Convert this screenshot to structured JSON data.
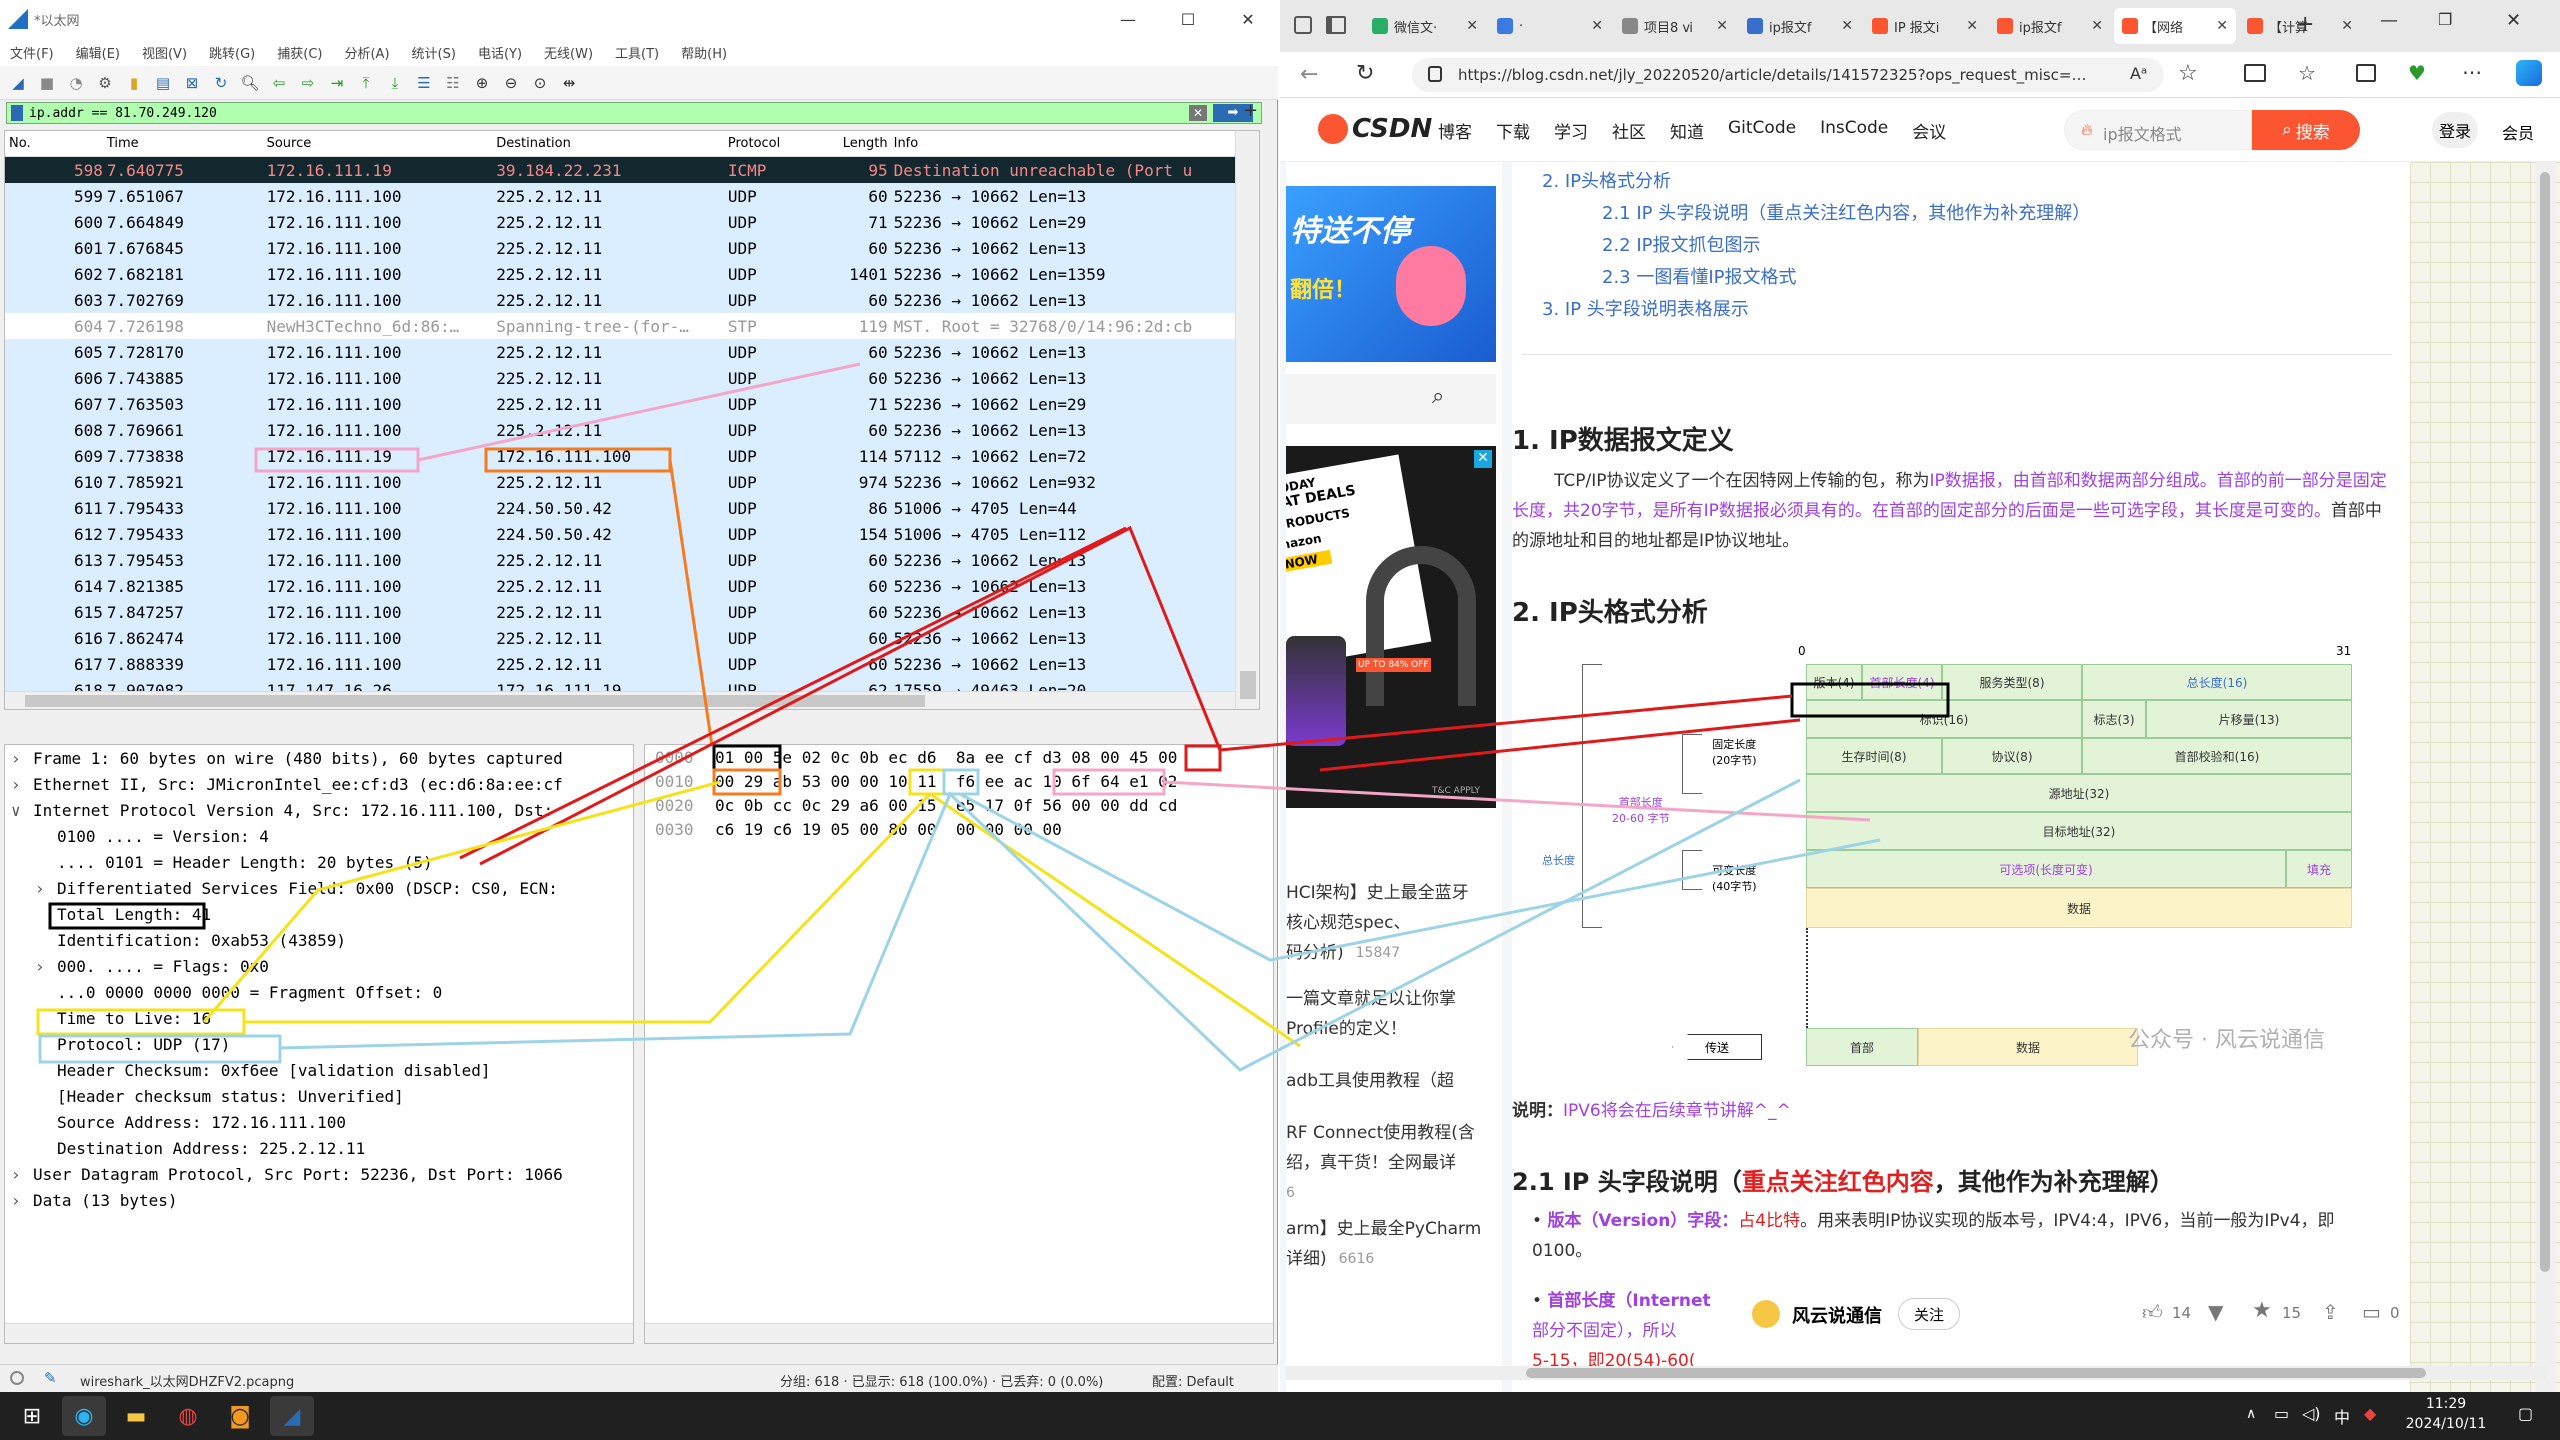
{
  "wireshark": {
    "title": "*以太网",
    "menu": [
      "文件(F)",
      "编辑(E)",
      "视图(V)",
      "跳转(G)",
      "捕获(C)",
      "分析(A)",
      "统计(S)",
      "电话(Y)",
      "无线(W)",
      "工具(T)",
      "帮助(H)"
    ],
    "filter": "ip.addr == 81.70.249.120",
    "columns": {
      "no": "No.",
      "time": "Time",
      "source": "Source",
      "destination": "Destination",
      "protocol": "Protocol",
      "length": "Length",
      "info": "Info"
    },
    "packets": [
      {
        "no": "598",
        "time": "7.640775",
        "src": "172.16.111.19",
        "dst": "39.184.22.231",
        "proto": "ICMP",
        "len": "95",
        "info": "Destination unreachable (Port u",
        "style": "sel"
      },
      {
        "no": "599",
        "time": "7.651067",
        "src": "172.16.111.100",
        "dst": "225.2.12.11",
        "proto": "UDP",
        "len": "60",
        "info": "52236 → 10662 Len=13",
        "style": "udp"
      },
      {
        "no": "600",
        "time": "7.664849",
        "src": "172.16.111.100",
        "dst": "225.2.12.11",
        "proto": "UDP",
        "len": "71",
        "info": "52236 → 10662 Len=29",
        "style": "udp"
      },
      {
        "no": "601",
        "time": "7.676845",
        "src": "172.16.111.100",
        "dst": "225.2.12.11",
        "proto": "UDP",
        "len": "60",
        "info": "52236 → 10662 Len=13",
        "style": "udp"
      },
      {
        "no": "602",
        "time": "7.682181",
        "src": "172.16.111.100",
        "dst": "225.2.12.11",
        "proto": "UDP",
        "len": "1401",
        "info": "52236 → 10662 Len=1359",
        "style": "udp"
      },
      {
        "no": "603",
        "time": "7.702769",
        "src": "172.16.111.100",
        "dst": "225.2.12.11",
        "proto": "UDP",
        "len": "60",
        "info": "52236 → 10662 Len=13",
        "style": "udp"
      },
      {
        "no": "604",
        "time": "7.726198",
        "src": "NewH3CTechno_6d:86:…",
        "dst": "Spanning-tree-(for-…",
        "proto": "STP",
        "len": "119",
        "info": "MST. Root = 32768/0/14:96:2d:cb",
        "style": "stp"
      },
      {
        "no": "605",
        "time": "7.728170",
        "src": "172.16.111.100",
        "dst": "225.2.12.11",
        "proto": "UDP",
        "len": "60",
        "info": "52236 → 10662 Len=13",
        "style": "udp"
      },
      {
        "no": "606",
        "time": "7.743885",
        "src": "172.16.111.100",
        "dst": "225.2.12.11",
        "proto": "UDP",
        "len": "60",
        "info": "52236 → 10662 Len=13",
        "style": "udp"
      },
      {
        "no": "607",
        "time": "7.763503",
        "src": "172.16.111.100",
        "dst": "225.2.12.11",
        "proto": "UDP",
        "len": "71",
        "info": "52236 → 10662 Len=29",
        "style": "udp"
      },
      {
        "no": "608",
        "time": "7.769661",
        "src": "172.16.111.100",
        "dst": "225.2.12.11",
        "proto": "UDP",
        "len": "60",
        "info": "52236 → 10662 Len=13",
        "style": "udp"
      },
      {
        "no": "609",
        "time": "7.773838",
        "src": "172.16.111.19",
        "dst": "172.16.111.100",
        "proto": "UDP",
        "len": "114",
        "info": "57112 → 10662 Len=72",
        "style": "udp"
      },
      {
        "no": "610",
        "time": "7.785921",
        "src": "172.16.111.100",
        "dst": "225.2.12.11",
        "proto": "UDP",
        "len": "974",
        "info": "52236 → 10662 Len=932",
        "style": "udp"
      },
      {
        "no": "611",
        "time": "7.795433",
        "src": "172.16.111.100",
        "dst": "224.50.50.42",
        "proto": "UDP",
        "len": "86",
        "info": "51006 → 4705 Len=44",
        "style": "udp"
      },
      {
        "no": "612",
        "time": "7.795433",
        "src": "172.16.111.100",
        "dst": "224.50.50.42",
        "proto": "UDP",
        "len": "154",
        "info": "51006 → 4705 Len=112",
        "style": "udp"
      },
      {
        "no": "613",
        "time": "7.795453",
        "src": "172.16.111.100",
        "dst": "225.2.12.11",
        "proto": "UDP",
        "len": "60",
        "info": "52236 → 10662 Len=13",
        "style": "udp"
      },
      {
        "no": "614",
        "time": "7.821385",
        "src": "172.16.111.100",
        "dst": "225.2.12.11",
        "proto": "UDP",
        "len": "60",
        "info": "52236 → 10662 Len=13",
        "style": "udp"
      },
      {
        "no": "615",
        "time": "7.847257",
        "src": "172.16.111.100",
        "dst": "225.2.12.11",
        "proto": "UDP",
        "len": "60",
        "info": "52236 → 10662 Len=13",
        "style": "udp"
      },
      {
        "no": "616",
        "time": "7.862474",
        "src": "172.16.111.100",
        "dst": "225.2.12.11",
        "proto": "UDP",
        "len": "60",
        "info": "52236 → 10662 Len=13",
        "style": "udp"
      },
      {
        "no": "617",
        "time": "7.888339",
        "src": "172.16.111.100",
        "dst": "225.2.12.11",
        "proto": "UDP",
        "len": "60",
        "info": "52236 → 10662 Len=13",
        "style": "udp"
      },
      {
        "no": "618",
        "time": "7.907082",
        "src": "117.147.16.26",
        "dst": "172.16.111.19",
        "proto": "UDP",
        "len": "62",
        "info": "17559 → 49463 Len=20",
        "style": "udp"
      }
    ],
    "details": [
      {
        "text": "Frame 1: 60 bytes on wire (480 bits), 60 bytes captured",
        "indent": 0,
        "exp": "›"
      },
      {
        "text": "Ethernet II, Src: JMicronIntel_ee:cf:d3 (ec:d6:8a:ee:cf",
        "indent": 0,
        "exp": "›"
      },
      {
        "text": "Internet Protocol Version 4, Src: 172.16.111.100, Dst:",
        "indent": 0,
        "exp": "∨"
      },
      {
        "text": "0100 .... = Version: 4",
        "indent": 2,
        "exp": ""
      },
      {
        "text": ".... 0101 = Header Length: 20 bytes (5)",
        "indent": 2,
        "exp": ""
      },
      {
        "text": "Differentiated Services Field: 0x00 (DSCP: CS0, ECN:",
        "indent": 2,
        "exp": "›"
      },
      {
        "text": "Total Length: 41",
        "indent": 2,
        "exp": ""
      },
      {
        "text": "Identification: 0xab53 (43859)",
        "indent": 2,
        "exp": ""
      },
      {
        "text": "000. .... = Flags: 0x0",
        "indent": 2,
        "exp": "›"
      },
      {
        "text": "...0 0000 0000 0000 = Fragment Offset: 0",
        "indent": 2,
        "exp": ""
      },
      {
        "text": "Time to Live: 16",
        "indent": 2,
        "exp": ""
      },
      {
        "text": "Protocol: UDP (17)",
        "indent": 2,
        "exp": ""
      },
      {
        "text": "Header Checksum: 0xf6ee [validation disabled]",
        "indent": 2,
        "exp": ""
      },
      {
        "text": "[Header checksum status: Unverified]",
        "indent": 2,
        "exp": ""
      },
      {
        "text": "Source Address: 172.16.111.100",
        "indent": 2,
        "exp": ""
      },
      {
        "text": "Destination Address: 225.2.12.11",
        "indent": 2,
        "exp": ""
      },
      {
        "text": "User Datagram Protocol, Src Port: 52236, Dst Port: 1066",
        "indent": 0,
        "exp": "›"
      },
      {
        "text": "Data (13 bytes)",
        "indent": 0,
        "exp": "›"
      }
    ],
    "bytes": [
      {
        "off": "0000",
        "hex": "01 00 5e 02 0c 0b ec d6  8a ee cf d3 08 00 45 00"
      },
      {
        "off": "0010",
        "hex": "00 29 ab 53 00 00 10 11  f6 ee ac 10 6f 64 e1 02"
      },
      {
        "off": "0020",
        "hex": "0c 0b cc 0c 29 a6 00 15  e5 17 0f 56 00 00 dd cd"
      },
      {
        "off": "0030",
        "hex": "c6 19 c6 19 05 00 80 00  00 00 00 00"
      }
    ],
    "status": {
      "file": "wireshark_以太网DHZFV2.pcapng",
      "counts": "分组: 618 · 已显示: 618 (100.0%) · 已丢弃: 0 (0.0%)",
      "profile": "配置: Default"
    }
  },
  "browser": {
    "tabs": [
      {
        "label": "微信文·",
        "color": "#2aae67"
      },
      {
        "label": "·",
        "color": "#3b7be0"
      },
      {
        "label": "项目8 ⅵ",
        "color": "#888"
      },
      {
        "label": "ip报文f",
        "color": "#3a6ecc"
      },
      {
        "label": "IP 报文i",
        "color": "#fc5531"
      },
      {
        "label": "ip报文f",
        "color": "#fc5531"
      },
      {
        "label": "【网络",
        "color": "#fc5531"
      },
      {
        "label": "【计算",
        "color": "#fc5531"
      }
    ],
    "url": "https://blog.csdn.net/jly_20220520/article/details/141572325?ops_request_misc=…",
    "csdn": {
      "logo": "CSDN",
      "nav": [
        "博客",
        "下载",
        "学习",
        "社区",
        "知道",
        "GitCode",
        "InsCode",
        "会议"
      ],
      "search_placeholder": "ip报文格式",
      "search_btn": "搜索",
      "login": "登录",
      "member": "会员"
    },
    "toc": [
      {
        "text": "2. IP头格式分析",
        "level": 1
      },
      {
        "text": "2.1 IP 头字段说明（重点关注红色内容，其他作为补充理解）",
        "level": 2
      },
      {
        "text": "2.2 IP报文抓包图示",
        "level": 2
      },
      {
        "text": "2.3 一图看懂IP报文格式",
        "level": 2
      },
      {
        "text": "3. IP 头字段说明表格展示",
        "level": 1
      }
    ],
    "sec1_title": "1. IP数据报文定义",
    "sec1_p1": "TCP/IP协议定义了一个在因特网上传输的包，称为",
    "sec1_p1b": "IP数据报，由首部和数据两部分组成。首部的前一部分是固定长度，共20字节，是所有IP数据报必须具有的。在首部的固定部分的后面是一些可选字段，其长度是可变的。",
    "sec1_p1c": "首部中的源地址和目的地址都是IP协议地址。",
    "sec2_title": "2. IP头格式分析",
    "note_label": "说明：",
    "note_text": "IPV6将会在后续章节讲解^_^",
    "sec21_title_a": "2.1 IP 头字段说明（",
    "sec21_title_b": "重点关注红色内容",
    "sec21_title_c": "，其他作为补充理解）",
    "bullet1_a": "版本（Version）字段：",
    "bullet1_b": "占4比特",
    "bullet1_c": "。用来表明IP协议实现的版本号，IPV4:4，IPV6，当前一般为IPv4，即0100。",
    "bullet2_a": "首部长度（Internet",
    "bullet2_b": "部分不固定），所以",
    "bullet2_c": "5-15，即20(54)-60(",
    "diagram": {
      "scale0": "0",
      "scale31": "31",
      "row1": [
        "版本(4)",
        "首部长度(4)",
        "服务类型(8)",
        "总长度(16)"
      ],
      "row2": [
        "标识(16)",
        "标志(3)",
        "片移量(13)"
      ],
      "row3": [
        "生存时间(8)",
        "协议(8)",
        "首部校验和(16)"
      ],
      "src": "源地址(32)",
      "dst": "目标地址(32)",
      "opt": "可选项(长度可变)",
      "pad": "填充",
      "data": "数据",
      "fixed": "固定长度\n(20字节)",
      "var": "可变长度\n(40字节)",
      "total": "总长度",
      "hdrlen": "首部长度\n20-60 字节",
      "send": "传送",
      "hdr": "首部",
      "body": "数据",
      "watermark": "公众号 · 风云说通信"
    },
    "left_items": [
      "HCI架构】史上最全蓝牙",
      "核心规范spec、",
      "码分析)",
      "15847",
      "一篇文章就足以让你掌",
      "Profile的定义！",
      "adb工具使用教程（超",
      "RF Connect使用教程(含",
      "绍，真干货！全网最详",
      "6",
      "arm】史上最全PyCharm",
      "详细)",
      "6616"
    ],
    "ad_banner_text": "特送不停",
    "ad_banner_sub": "翻倍！",
    "ad2_title": "T TODAY",
    "ad2_text": "REAT DEALS",
    "ad2_sub": "E PRODUCTS",
    "ad2_amazon": "Amazon",
    "ad2_shop": "P NOW",
    "ad2_off": "UP TO 84% OFF",
    "ad2_apply": "T&C APPLY",
    "author": "风云说通信",
    "follow": "关注",
    "likes": "14",
    "stars": "15",
    "comments": "0"
  },
  "taskbar": {
    "time": "11:29",
    "date": "2024/10/11",
    "ime": "中"
  }
}
